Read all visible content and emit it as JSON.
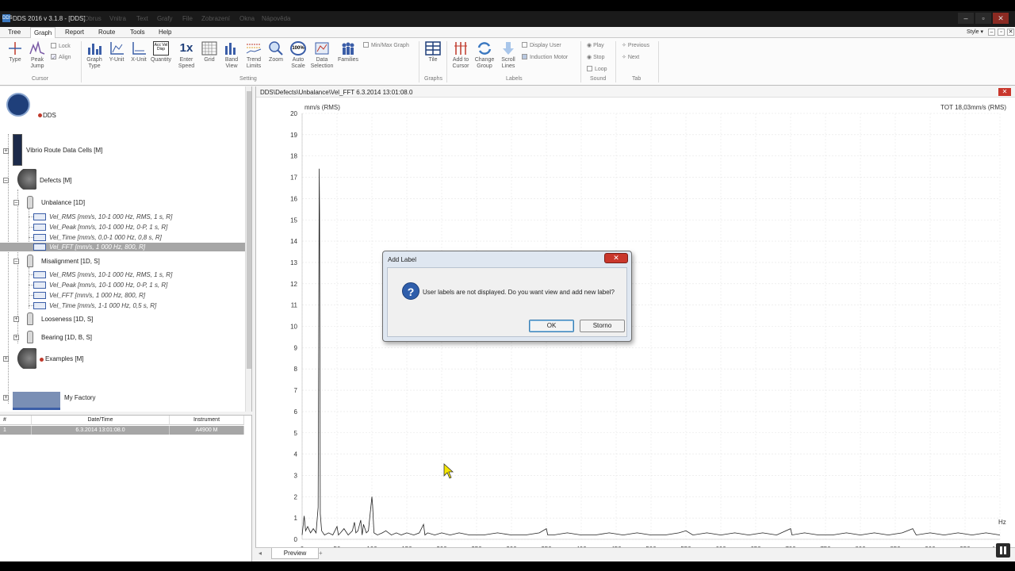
{
  "window": {
    "title": "DDS 2016 v 3.1.8 - [DDS]",
    "app_icon": "DDS",
    "background_menu": [
      "Obrus",
      "Vnitra",
      "Text",
      "Grafy",
      "File",
      "Zobrazení",
      "Okna",
      "Nápověda"
    ]
  },
  "menu": {
    "tabs": [
      "Tree",
      "Graph",
      "Report",
      "Route",
      "Tools",
      "Help"
    ],
    "active_tab": "Graph",
    "style_label": "Style"
  },
  "ribbon": {
    "cursor_group": {
      "label": "Cursor",
      "buttons": [
        "Type",
        "Peak Jump"
      ],
      "checks": [
        "Lock",
        "Align"
      ]
    },
    "setting_group": {
      "label": "Setting",
      "buttons": [
        "Graph Type",
        "Y-Unit",
        "X-Unit",
        "Quantity",
        "Enter Speed",
        "Grid",
        "Band View",
        "Trend Limits",
        "Zoom",
        "Auto Scale",
        "Data Selection",
        "Families"
      ],
      "enter_speed_icon_text": "1x",
      "auto_scale_icon_text": "100%",
      "quantity_icon_text": "Acc Vel Disp",
      "check": "Min/Max Graph"
    },
    "graphs_group": {
      "label": "Graphs",
      "buttons": [
        "Tile"
      ]
    },
    "labels_group": {
      "label": "Labels",
      "buttons": [
        "Add to Cursor",
        "Change Group",
        "Scroll Lines"
      ],
      "checks": [
        "Display User",
        "Induction Motor"
      ]
    },
    "sound_group": {
      "label": "Sound",
      "buttons": [
        "Play",
        "Stop",
        "Loop"
      ]
    },
    "tab_group": {
      "label": "Tab",
      "buttons": [
        "Previous",
        "Next"
      ]
    }
  },
  "tree": {
    "root": "DDS",
    "nodes": [
      {
        "label": "Vibrio Route Data Cells [M]"
      },
      {
        "label": "Defects [M]"
      },
      {
        "label": "Unbalance [1D]"
      },
      {
        "label": "Vel_RMS [mm/s, 10-1 000 Hz, RMS, 1 s, R]"
      },
      {
        "label": "Vel_Peak [mm/s, 10-1 000 Hz, 0-P, 1 s, R]"
      },
      {
        "label": "Vel_Time [mm/s, 0,0-1 000 Hz, 0,8 s, R]"
      },
      {
        "label": "Vel_FFT [mm/s, 1 000 Hz, 800, R]"
      },
      {
        "label": "Misalignment [1D, S]"
      },
      {
        "label": "Vel_RMS [mm/s, 10-1 000 Hz, RMS, 1 s, R]"
      },
      {
        "label": "Vel_Peak [mm/s, 10-1 000 Hz, 0-P, 1 s, R]"
      },
      {
        "label": "Vel_FFT [mm/s, 1 000 Hz, 800, R]"
      },
      {
        "label": "Vel_Time [mm/s, 1-1 000 Hz, 0,5 s, R]"
      },
      {
        "label": "Looseness [1D, S]"
      },
      {
        "label": "Bearing [1D, B, S]"
      },
      {
        "label": "Examples [M]"
      },
      {
        "label": "My Factory"
      }
    ]
  },
  "records": {
    "columns": [
      "#",
      "Date/Time",
      "Instrument"
    ],
    "rows": [
      {
        "num": "1",
        "datetime": "6.3.2014 13:01:08.0",
        "instrument": "A4900 M"
      }
    ]
  },
  "main": {
    "path": "DDS\\Defects\\Unbalance\\Vel_FFT     6.3.2014 13:01:08.0",
    "close_label": "✕"
  },
  "chart_data": {
    "type": "line",
    "ylabel": "mm/s (RMS)",
    "xunit": "Hz",
    "total_label": "TOT 18,03mm/s (RMS)",
    "xlim": [
      0,
      1000
    ],
    "ylim": [
      0,
      20
    ],
    "xticks": [
      "0",
      "50",
      "100",
      "150",
      "200",
      "250",
      "300",
      "350",
      "400",
      "450",
      "500",
      "550",
      "600",
      "650",
      "700",
      "750",
      "800",
      "850",
      "900",
      "950",
      "1 000"
    ],
    "yticks": [
      "0",
      "1",
      "2",
      "3",
      "4",
      "5",
      "6",
      "7",
      "8",
      "9",
      "10",
      "11",
      "12",
      "13",
      "14",
      "15",
      "16",
      "17",
      "18",
      "19",
      "20"
    ],
    "grid": true,
    "series": [
      {
        "x": [
          0,
          3,
          5,
          8,
          12,
          16,
          20,
          23,
          24.5,
          25,
          26,
          28,
          32,
          38,
          44,
          50,
          52,
          55,
          60,
          66,
          72,
          75,
          77,
          80,
          84,
          86,
          88,
          92,
          95,
          100,
          101,
          103,
          108,
          115,
          120,
          128,
          135,
          142,
          150,
          160,
          168,
          174,
          176,
          180,
          190,
          200,
          212,
          225,
          240,
          260,
          280,
          300,
          320,
          340,
          350,
          352,
          360,
          380,
          400,
          420,
          440,
          460,
          480,
          500,
          520,
          540,
          550,
          560,
          580,
          600,
          620,
          640,
          660,
          680,
          700,
          702,
          720,
          740,
          760,
          780,
          800,
          820,
          840,
          860,
          875,
          880,
          900,
          920,
          940,
          960,
          980,
          1000
        ],
        "y": [
          0.2,
          1.1,
          0.4,
          0.6,
          0.3,
          0.5,
          0.3,
          1.5,
          17.4,
          15.3,
          1.2,
          0.4,
          0.2,
          0.3,
          0.2,
          0.6,
          0.2,
          0.3,
          0.5,
          0.2,
          0.4,
          0.8,
          0.3,
          0.4,
          0.9,
          0.2,
          0.7,
          0.3,
          0.4,
          2.0,
          1.6,
          0.3,
          0.2,
          0.3,
          0.4,
          0.2,
          0.3,
          0.2,
          0.3,
          0.2,
          0.3,
          0.7,
          0.2,
          0.3,
          0.2,
          0.3,
          0.2,
          0.3,
          0.2,
          0.2,
          0.3,
          0.2,
          0.2,
          0.3,
          0.5,
          0.2,
          0.2,
          0.3,
          0.2,
          0.2,
          0.3,
          0.2,
          0.3,
          0.2,
          0.2,
          0.3,
          0.4,
          0.2,
          0.3,
          0.2,
          0.3,
          0.2,
          0.3,
          0.2,
          0.5,
          0.2,
          0.3,
          0.2,
          0.2,
          0.3,
          0.2,
          0.3,
          0.2,
          0.3,
          0.5,
          0.2,
          0.3,
          0.2,
          0.3,
          0.2,
          0.3,
          0.2
        ]
      }
    ]
  },
  "bottom_tabs": {
    "preview": "Preview",
    "prev_arrow": "◂",
    "add": "+"
  },
  "dialog": {
    "title": "Add Label",
    "message": "User labels are not displayed. Do you want view and add new label?",
    "ok": "OK",
    "cancel": "Storno",
    "icon": "?"
  },
  "colors": {
    "selection": "#a6a6a6",
    "close_red": "#c9372c",
    "dialog_frame": "#dfe7f1",
    "accent_blue": "#2f5eab"
  }
}
